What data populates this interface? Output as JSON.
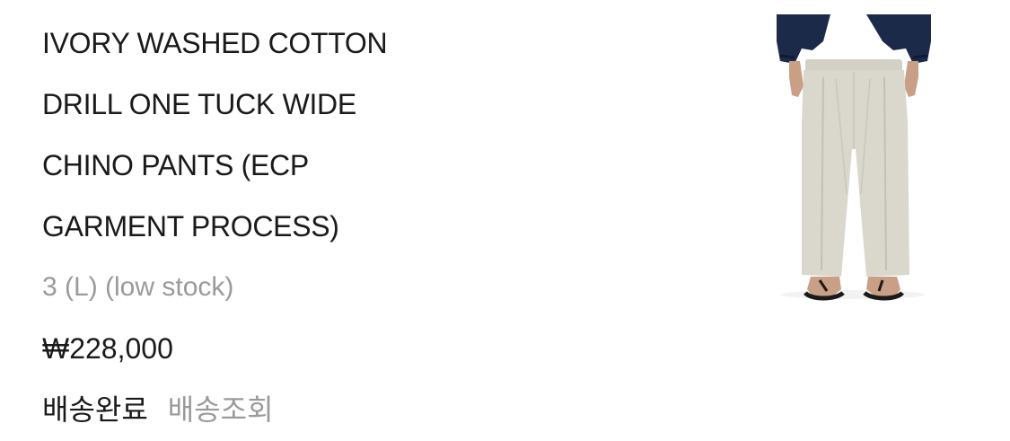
{
  "product": {
    "title_lines": [
      "IVORY WASHED COTTON",
      "DRILL ONE TUCK WIDE",
      "CHINO PANTS (ECP",
      "GARMENT PROCESS)"
    ],
    "option": "3 (L) (low stock)",
    "price": "₩228,000",
    "image_icon": "wide-chino-pants-photo"
  },
  "status": {
    "label": "배송완료",
    "track_link": "배송조회"
  },
  "colors": {
    "text_primary": "#1a1a1a",
    "text_secondary": "#9a9a9a",
    "pants": "#d9d6cc",
    "jacket": "#1c2a4a"
  }
}
